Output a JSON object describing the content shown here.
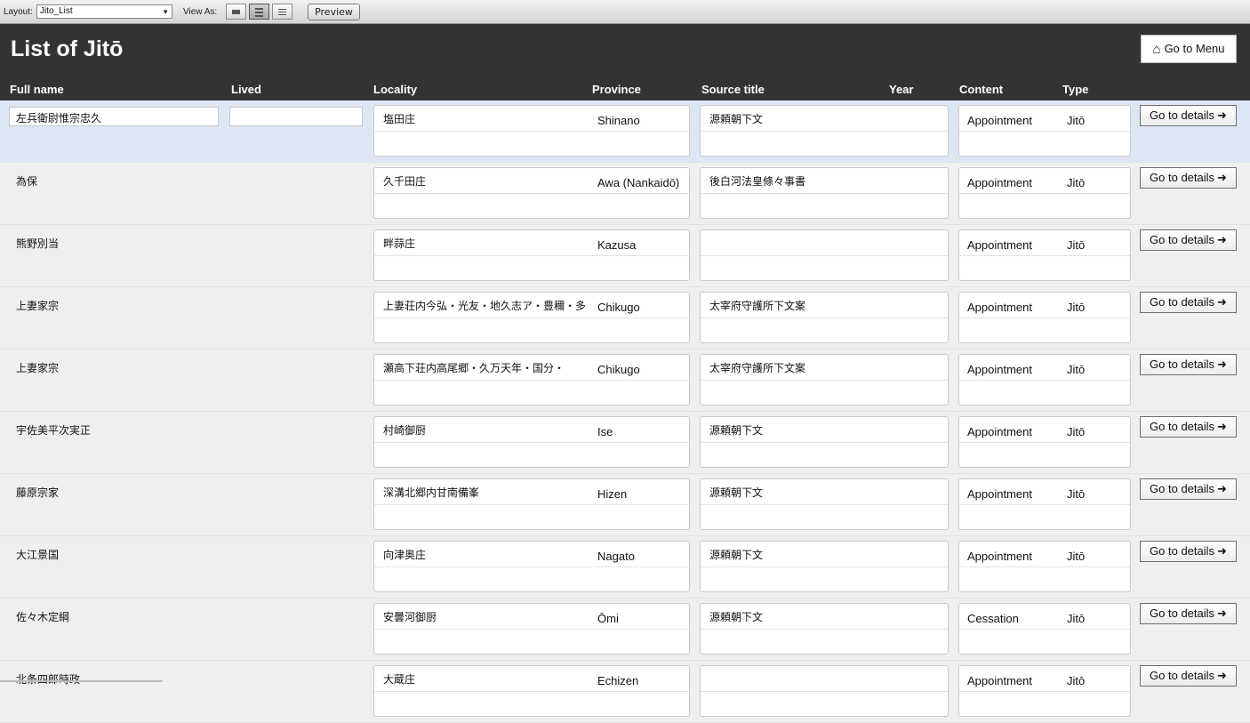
{
  "toolbar": {
    "layout_label": "Layout:",
    "layout_value": "Jito_List",
    "layout_arrow_icon": "dropdown-arrow-icon",
    "view_as_label": "View As:",
    "view_buttons": [
      {
        "icon": "form-view-icon"
      },
      {
        "icon": "list-view-icon",
        "active": true
      },
      {
        "icon": "table-view-icon"
      }
    ],
    "preview_label": "Preview"
  },
  "header": {
    "title": "List of Jitō",
    "menu_button": "Go to Menu",
    "menu_icon": "home-icon",
    "columns": {
      "full_name": "Full name",
      "lived": "Lived",
      "locality": "Locality",
      "province": "Province",
      "source_title": "Source title",
      "year": "Year",
      "content": "Content",
      "type": "Type"
    },
    "colors": {
      "header_bg": "#333333",
      "selected_row": "#dde7f3"
    }
  },
  "details_label": "Go to details",
  "details_icon": "arrow-right-icon",
  "rows": [
    {
      "name": "左兵衛尉惟宗忠久",
      "lived": "",
      "locality": "塩田庄",
      "province": "Shinano",
      "source": "源頼朝下文",
      "content": "Appointment",
      "type": "Jitō",
      "selected": true
    },
    {
      "name": "為保",
      "lived": "",
      "locality": "久千田庄",
      "province": "Awa (Nankaidō)",
      "source": "後白河法皇條々事書",
      "content": "Appointment",
      "type": "Jitō"
    },
    {
      "name": "熊野別当",
      "lived": "",
      "locality": "畔蒜庄",
      "province": "Kazusa",
      "source": "",
      "content": "Appointment",
      "type": "Jitō"
    },
    {
      "name": "上妻家宗",
      "lived": "",
      "locality": "上妻荘内今弘・光友・地久志ア・豊穪・多",
      "province": "Chikugo",
      "source": "太宰府守護所下文案",
      "content": "Appointment",
      "type": "Jitō"
    },
    {
      "name": "上妻家宗",
      "lived": "",
      "locality": "瀬高下荘内高尾郷・久万天年・国分・",
      "province": "Chikugo",
      "source": "太宰府守護所下文案",
      "content": "Appointment",
      "type": "Jitō"
    },
    {
      "name": "宇佐美平次実正",
      "lived": "",
      "locality": "村崎御厨",
      "province": "Ise",
      "source": "源頼朝下文",
      "content": "Appointment",
      "type": "Jitō"
    },
    {
      "name": "藤原宗家",
      "lived": "",
      "locality": "深溝北郷内甘南備峯",
      "province": "Hizen",
      "source": "源頼朝下文",
      "content": "Appointment",
      "type": "Jitō"
    },
    {
      "name": "大江景国",
      "lived": "",
      "locality": "向津奥庄",
      "province": "Nagato",
      "source": "源頼朝下文",
      "content": "Appointment",
      "type": "Jitō"
    },
    {
      "name": "佐々木定綱",
      "lived": "",
      "locality": "安曇河御厨",
      "province": "Ōmi",
      "source": "源頼朝下文",
      "content": "Cessation",
      "type": "Jitō"
    },
    {
      "name": "北条四郎時政",
      "lived": "",
      "locality": "大蔵庄",
      "province": "Echizen",
      "source": "",
      "content": "Appointment",
      "type": "Jitō"
    }
  ]
}
